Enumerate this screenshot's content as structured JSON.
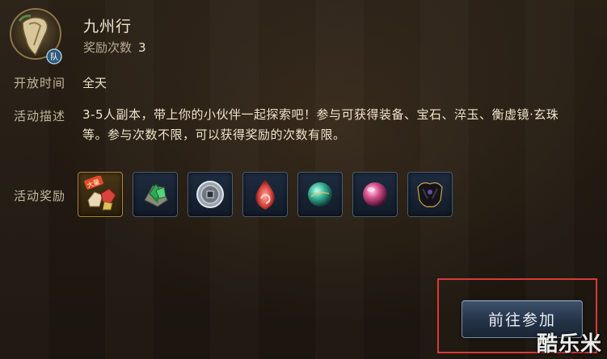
{
  "activity": {
    "title": "九州行",
    "reward_count_label": "奖励次数",
    "reward_count": "3",
    "team_badge": "队"
  },
  "open_time": {
    "label": "开放时间",
    "value": "全天"
  },
  "description": {
    "label": "活动描述",
    "text": "3-5人副本，带上你的小伙伴一起探索吧！参与可获得装备、宝石、淬玉、衡虚镜·玄珠等。参与次数不限，可以获得奖励的次数有限。"
  },
  "rewards": {
    "label": "活动奖励",
    "items": [
      {
        "icon": "gem-pack-icon",
        "badge": "大量"
      },
      {
        "icon": "green-crystal-icon"
      },
      {
        "icon": "silver-coin-icon"
      },
      {
        "icon": "red-flame-orb-icon"
      },
      {
        "icon": "teal-orb-icon"
      },
      {
        "icon": "pink-orb-icon"
      },
      {
        "icon": "dark-cloak-icon"
      }
    ]
  },
  "actions": {
    "join_label": "前往参加"
  },
  "watermark": "酷乐米",
  "colors": {
    "highlight_border": "#d83a3a",
    "button_bg": "#243347",
    "text_primary": "#f0e4ca",
    "text_label": "#c3b69c"
  }
}
